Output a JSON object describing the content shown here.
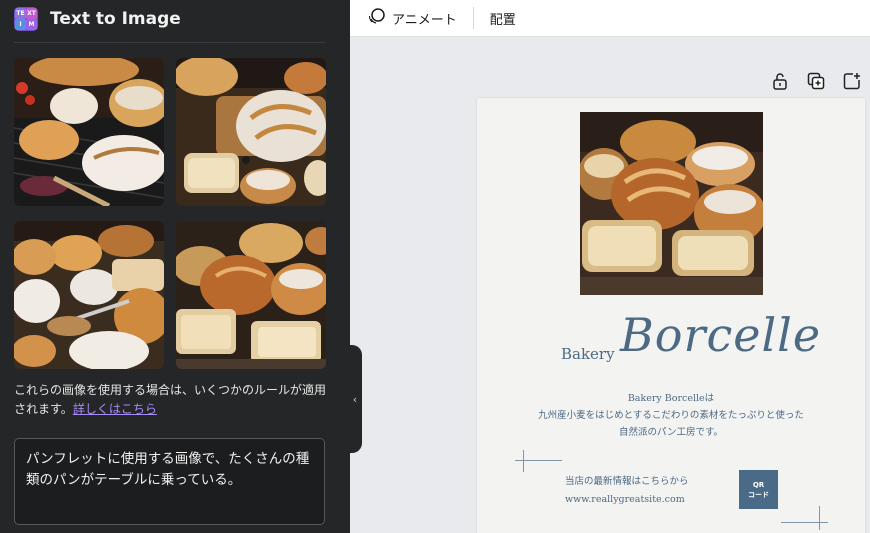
{
  "panel": {
    "title": "Text to Image",
    "app_icon_text": [
      "TE",
      "XT",
      "I",
      "M"
    ],
    "results": [
      {
        "name": "result-image-1"
      },
      {
        "name": "result-image-2"
      },
      {
        "name": "result-image-3"
      },
      {
        "name": "result-image-4"
      }
    ],
    "notice_text": "これらの画像を使用する場合は、いくつかのルールが適用されます。",
    "notice_link": "詳しくはこちら",
    "prompt_text": "パンフレットに使用する画像で、たくさんの種類のパンがテーブルに乗っている。",
    "collapse_icon": "chevron-left-icon"
  },
  "toolbar": {
    "animate_label": "アニメート",
    "arrange_label": "配置"
  },
  "page_actions": [
    "lock-icon",
    "duplicate-icon",
    "add-page-icon"
  ],
  "design": {
    "bakery_label": "Bakery",
    "brand_name": "Borcelle",
    "desc_line1": "Bakery Borcelleは",
    "desc_line2": "九州産小麦をはじめとするこだわりの素材をたっぷりと使った",
    "desc_line3": "自然派のパン工房です。",
    "info_line1": "当店の最新情報はこちらから",
    "info_line2": "www.reallygreatsite.com",
    "qr_line1": "QR",
    "qr_line2": "コード",
    "accent_color": "#4d6a85"
  }
}
